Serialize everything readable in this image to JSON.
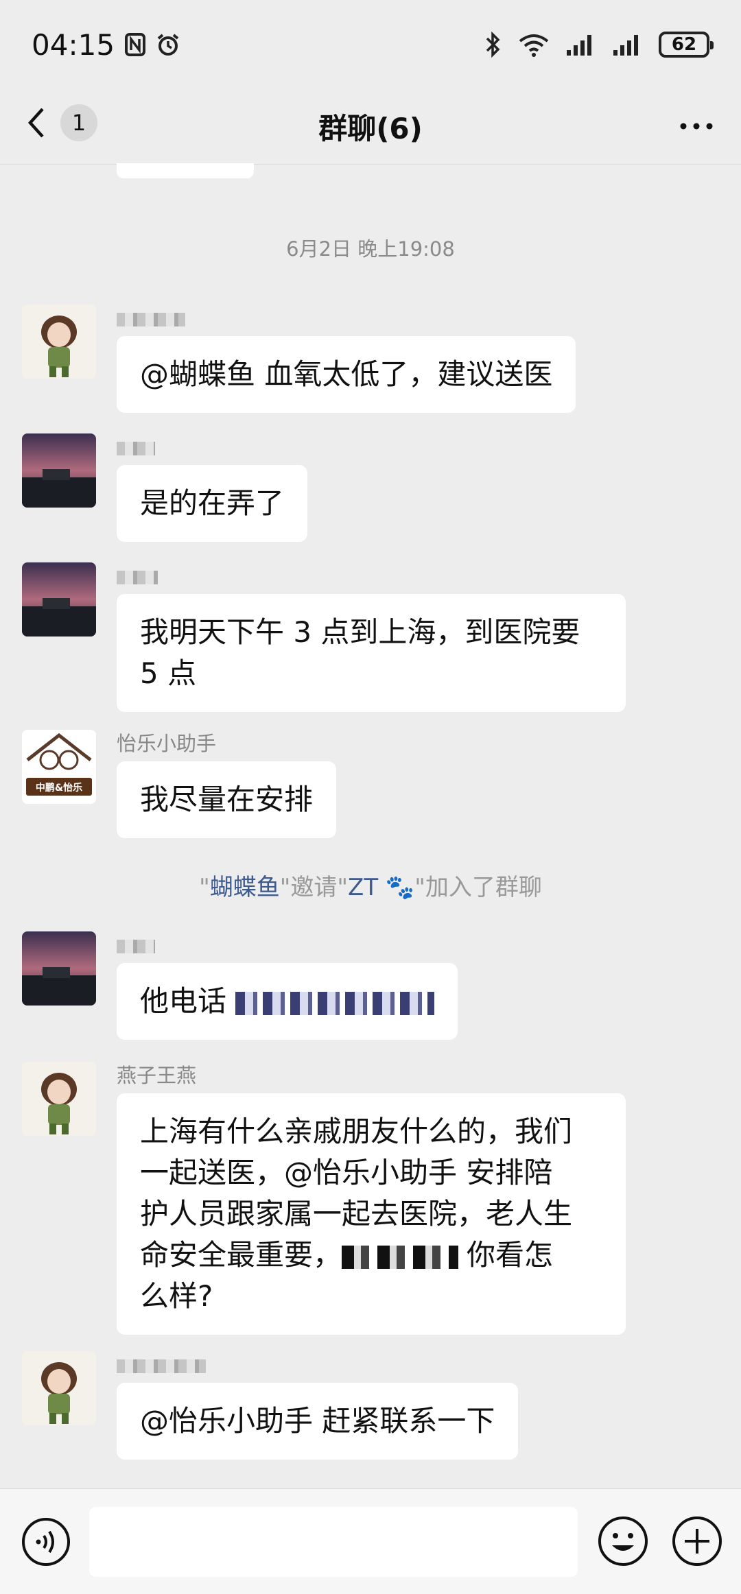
{
  "status_bar": {
    "time": "04:15",
    "battery": "62"
  },
  "header": {
    "back_count": "1",
    "title": "群聊(6)"
  },
  "timestamp": "6月2日 晚上19:08",
  "messages": [
    {
      "sender": "",
      "text": "@蝴蝶鱼  血氧太低了，建议送医"
    },
    {
      "sender": "",
      "text": "是的在弄了"
    },
    {
      "sender": "",
      "line1": "我明天下午 3 点到上海，到医院要",
      "line2": "5 点"
    },
    {
      "sender": "怡乐小助手",
      "text": "我尽量在安排",
      "avatar_label": "中鹏&怡乐"
    },
    {
      "sender": "",
      "text": "他电话"
    },
    {
      "sender": "燕子王燕",
      "line1": "上海有什么亲戚朋友什么的，我们",
      "line2": "一起送医，@怡乐小助手  安排陪",
      "line3": "护人员跟家属一起去医院，老人生",
      "line4a": "命安全最重要，",
      "line4b": "你看怎",
      "line5": "么样?"
    },
    {
      "sender": "",
      "text": "@怡乐小助手  赶紧联系一下"
    }
  ],
  "system": {
    "q1": "\"",
    "inviter": "蝴蝶鱼",
    "mid": "\"邀请\"",
    "invitee": "ZT 🐾",
    "end": "\"加入了群聊"
  },
  "colors": {
    "background": "#ededed",
    "bubble": "#ffffff",
    "link": "#3d5a8f"
  }
}
